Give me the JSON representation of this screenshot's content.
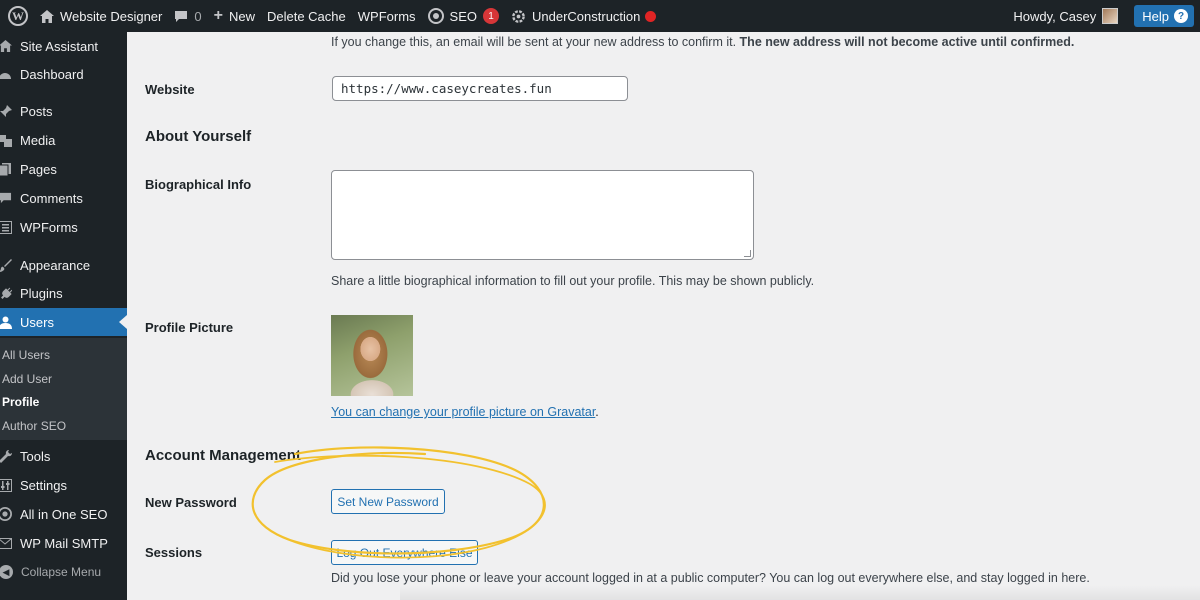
{
  "admin_bar": {
    "site_name": "Website Designer",
    "comments_count": "0",
    "new_label": "New",
    "delete_cache_label": "Delete Cache",
    "wpforms_label": "WPForms",
    "seo_label": "SEO",
    "seo_badge": "1",
    "underconstruction_label": "UnderConstruction",
    "howdy_label": "Howdy, Casey",
    "help_label": "Help",
    "help_icon": "?"
  },
  "sidebar": {
    "items": [
      {
        "label": "Site Assistant",
        "icon": "home-icon"
      },
      {
        "label": "Dashboard",
        "icon": "dashboard-icon"
      },
      {
        "label": "Posts",
        "icon": "pin-icon"
      },
      {
        "label": "Media",
        "icon": "media-icon"
      },
      {
        "label": "Pages",
        "icon": "pages-icon"
      },
      {
        "label": "Comments",
        "icon": "comment-icon"
      },
      {
        "label": "WPForms",
        "icon": "form-icon"
      },
      {
        "label": "Appearance",
        "icon": "brush-icon"
      },
      {
        "label": "Plugins",
        "icon": "plugin-icon"
      },
      {
        "label": "Users",
        "icon": "user-icon"
      },
      {
        "label": "Tools",
        "icon": "wrench-icon"
      },
      {
        "label": "Settings",
        "icon": "settings-icon"
      },
      {
        "label": "All in One SEO",
        "icon": "seo-icon"
      },
      {
        "label": "WP Mail SMTP",
        "icon": "mail-icon"
      }
    ],
    "submenu": [
      "All Users",
      "Add User",
      "Profile",
      "Author SEO"
    ],
    "collapse_label": "Collapse Menu"
  },
  "content": {
    "email_note_regular": "If you change this, an email will be sent at your new address to confirm it.",
    "email_note_bold": "The new address will not become active until confirmed.",
    "website_label": "Website",
    "website_value": "https://www.caseycreates.fun",
    "about_heading": "About Yourself",
    "bio_label": "Biographical Info",
    "bio_value": "",
    "bio_description": "Share a little biographical information to fill out your profile. This may be shown publicly.",
    "profile_picture_label": "Profile Picture",
    "gravatar_link": "You can change your profile picture on Gravatar",
    "gravatar_period": ".",
    "account_heading": "Account Management",
    "new_password_label": "New Password",
    "set_password_button": "Set New Password",
    "sessions_label": "Sessions",
    "logout_button": "Log Out Everywhere Else",
    "sessions_description": "Did you lose your phone or leave your account logged in at a public computer? You can log out everywhere else, and stay logged in here."
  },
  "colors": {
    "admin_bar": "#1d2327",
    "accent": "#2271b1",
    "highlight_annotation": "#f2c12e"
  }
}
